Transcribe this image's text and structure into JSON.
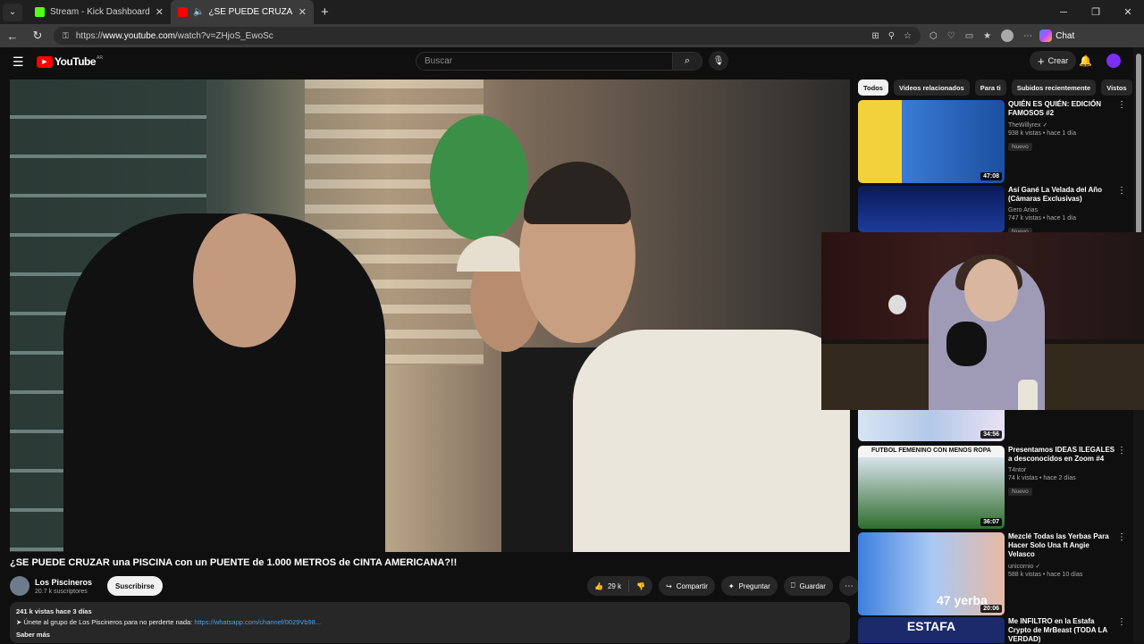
{
  "browser": {
    "tabs": [
      {
        "title": "Stream - Kick Dashboard",
        "active": false
      },
      {
        "title": "¿SE PUEDE CRUZAR una PISCINA",
        "active": true
      }
    ],
    "url_prefix": "https://",
    "url_host": "www.youtube.com",
    "url_path": "/watch?v=ZHjoS_EwoSc",
    "chat_label": "Chat"
  },
  "youtube": {
    "logo_text": "YouTube",
    "logo_country": "AR",
    "search_placeholder": "Buscar",
    "create_label": "Crear"
  },
  "video": {
    "title": "¿SE PUEDE CRUZAR una PISCINA con un PUENTE de 1.000 METROS de CINTA AMERICANA?!!",
    "channel": "Los Piscineros",
    "subscribers": "20.7 k suscriptores",
    "subscribe_label": "Suscribirse",
    "likes": "29 k",
    "share_label": "Compartir",
    "ask_label": "Preguntar",
    "save_label": "Guardar",
    "description": {
      "stats": "241 k vistas  hace 3 días",
      "line2_text": "➤ Únete al grupo de Los Piscineros para no perderte nada: ",
      "line2_link": "https://whatsapp.com/channel/0029Vb98...",
      "more": "Saber más"
    }
  },
  "chips": [
    "Todos",
    "Videos relacionados",
    "Para ti",
    "Subidos recientemente",
    "Vistos"
  ],
  "recommendations": [
    {
      "title": "QUIÉN ES QUIÉN: EDICIÓN FAMOSOS #2",
      "channel": "TheWillyrex ✓",
      "stats": "938 k vistas • hace 1 día",
      "badge": "Nuevo",
      "duration": "47:08"
    },
    {
      "title": "Así Gané La Velada del Año (Cámaras Exclusivas)",
      "channel": "Gero Arias",
      "stats": "747 k vistas • hace 1 día",
      "badge": "Nuevo",
      "duration": ""
    },
    {
      "title": "",
      "channel": "",
      "stats": "",
      "badge": "",
      "duration": "34:56"
    },
    {
      "title": "Presentamos IDEAS ILEGALES a desconocidos en Zoom #4",
      "channel": "T4ntor",
      "stats": "74 k vistas • hace 2 días",
      "badge": "Nuevo",
      "duration": "36:07",
      "thumb_text": "FUTBOL FEMENINO CON MENOS ROPA"
    },
    {
      "title": "Mezclé Todas las Yerbas Para Hacer Solo Una ft Angie Velasco",
      "channel": "unicornio ✓",
      "stats": "588 k vistas • hace 10 días",
      "badge": "",
      "duration": "20:06",
      "thumb_text": "47 yerba"
    },
    {
      "title": "Me INFILTRO en la Estafa Crypto de MrBeast (TODA LA VERDAD)",
      "channel": "",
      "stats": "",
      "badge": "",
      "duration": "",
      "thumb_text": "ESTAFA"
    }
  ],
  "colors": {
    "accent": "#ff0000",
    "link": "#3ea6ff",
    "bg": "#0f0f0f"
  }
}
